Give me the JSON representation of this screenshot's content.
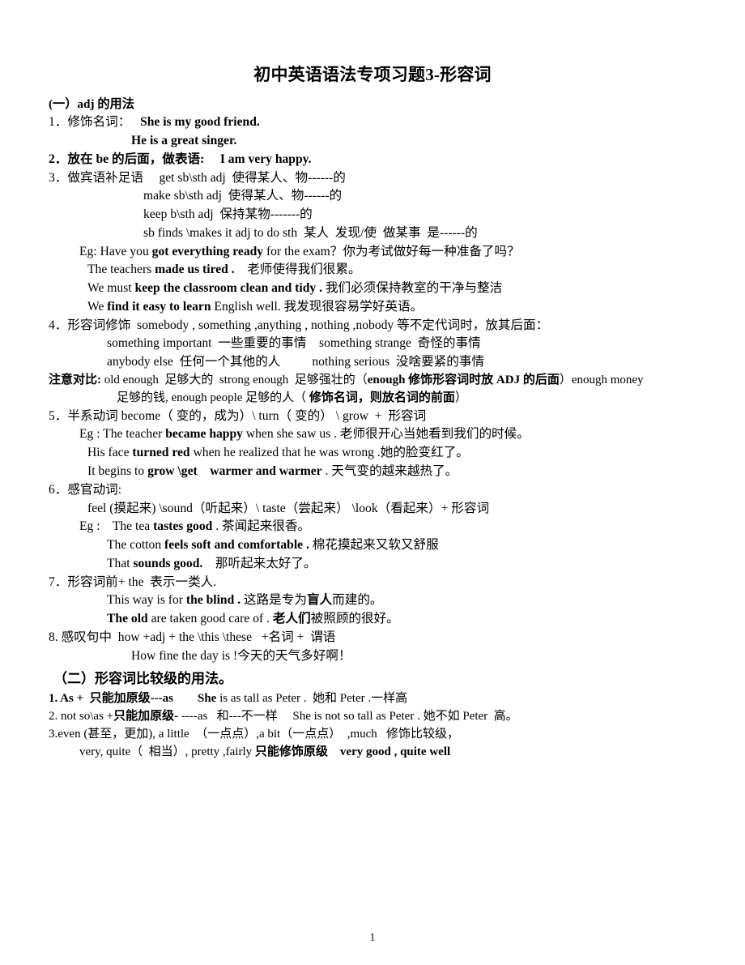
{
  "document": {
    "title": "初中英语语法专项习题3-形容词",
    "page_number": "1"
  },
  "section_one": {
    "heading": "(一）adj 的用法",
    "lines": {
      "l1": "1．修饰名词：",
      "l1b": "She is my good friend.",
      "l2b": "He is a great singer.",
      "l3": "2．放在 be 的后面，做表语:",
      "l3b": "I am very happy.",
      "l4": "3．做宾语补足语",
      "l4b": "get sb\\sth adj  使得某人、物------的",
      "l5": "make sb\\sth adj  使得某人、物------的",
      "l6": "keep b\\sth adj  保持某物-------的",
      "l7": "sb finds \\makes it adj to do sth  某人  发现/使  做某事  是------的",
      "eg_label": "Eg:",
      "eg1_a": "Have you ",
      "eg1_b": "got everything ready",
      "eg1_c": " for the exam？你为考试做好每一种准备了吗？",
      "eg2_a": "The teachers ",
      "eg2_b": "made us tired .",
      "eg2_c": "　老师使得我们很累。",
      "eg3_a": "We must ",
      "eg3_b": "keep the classroom clean and tidy .",
      "eg3_c": " 我们必须保持教室的干净与整洁",
      "eg4_a": "We ",
      "eg4_b": "find it easy to learn",
      "eg4_c": " English well. 我发现很容易学好英语。",
      "l8": "4．形容词修饰  somebody , something ,anything , nothing ,nobody 等不定代词时，放其后面：",
      "l9": "something important  一些重要的事情    something strange  奇怪的事情",
      "l10": "anybody else  任何一个其他的人          nothing serious  没啥要紧的事情",
      "note_label": "注意对比:",
      "note_a": " old enough  足够大的  strong enough  足够强壮的（",
      "note_b": "enough 修饰形容词时放 ADJ 的后面",
      "note_c": "）enough money",
      "note_d": "足够的钱, enough people 足够的人（ ",
      "note_e": "修饰名词，则放名词的前面",
      "note_f": "）",
      "l11": "5．半系动词 become（ 变的，成为）\\ turn（ 变的） \\ grow  +  形容词",
      "eg5_a": "Eg : The teacher ",
      "eg5_b": "became happy",
      "eg5_c": " when she saw us . 老师很开心当她看到我们的时候。",
      "eg6_a": "His face ",
      "eg6_b": "turned red",
      "eg6_c": " when he realized that he was wrong .她的脸变红了。",
      "eg7_a": "It begins to ",
      "eg7_b": "grow \\get    warmer and warmer",
      "eg7_c": " . 天气变的越来越热了。",
      "l12": "6．感官动词:",
      "l13": "feel (摸起来) \\sound（听起来）\\ taste（尝起来） \\look（看起来）+ 形容词",
      "eg8_a": "Eg :    The tea ",
      "eg8_b": "tastes good",
      "eg8_c": " . 茶闻起来很香。",
      "eg9_a": "The cotton ",
      "eg9_b": "feels soft and comfortable .",
      "eg9_c": " 棉花摸起来又软又舒服",
      "eg10_a": "That ",
      "eg10_b": "sounds good.",
      "eg10_c": "    那听起来太好了。",
      "l14": "7．形容词前+ the  表示一类人.",
      "eg11_a": "This way is for ",
      "eg11_b": "the blind .",
      "eg11_c": " 这路是专为",
      "eg11_d": "盲人",
      "eg11_e": "而建的。",
      "eg12_a": "The old",
      "eg12_b": " are taken good care of . ",
      "eg12_c": "老人们",
      "eg12_d": "被照顾的很好。",
      "l15": "8. 感叹句中  how +adj + the \\this \\these   +名词 +  谓语",
      "l16": "How fine the day is !今天的天气多好啊！"
    }
  },
  "section_two": {
    "heading": "（二）形容词比较级的用法。",
    "lines": {
      "l1_a": "1. As +  只能加原级---as",
      "l1_b": "She",
      "l1_c": " is as tall as Peter .  她和 Peter .一样高",
      "l2_a": "2. not so\\as +",
      "l2_b": "只能加原级-",
      "l2_c": " ----as   和---不一样     She is not so tall as Peter . 她不如 Peter  高。",
      "l3": "3.even (甚至，更加), a little  （一点点）,a bit（一点点）  ,much   修饰比较级，",
      "l4_a": "very, quite（  相当）, pretty ,fairly ",
      "l4_b": "只能修饰原级",
      "l4_c": "    very good , quite well"
    }
  }
}
